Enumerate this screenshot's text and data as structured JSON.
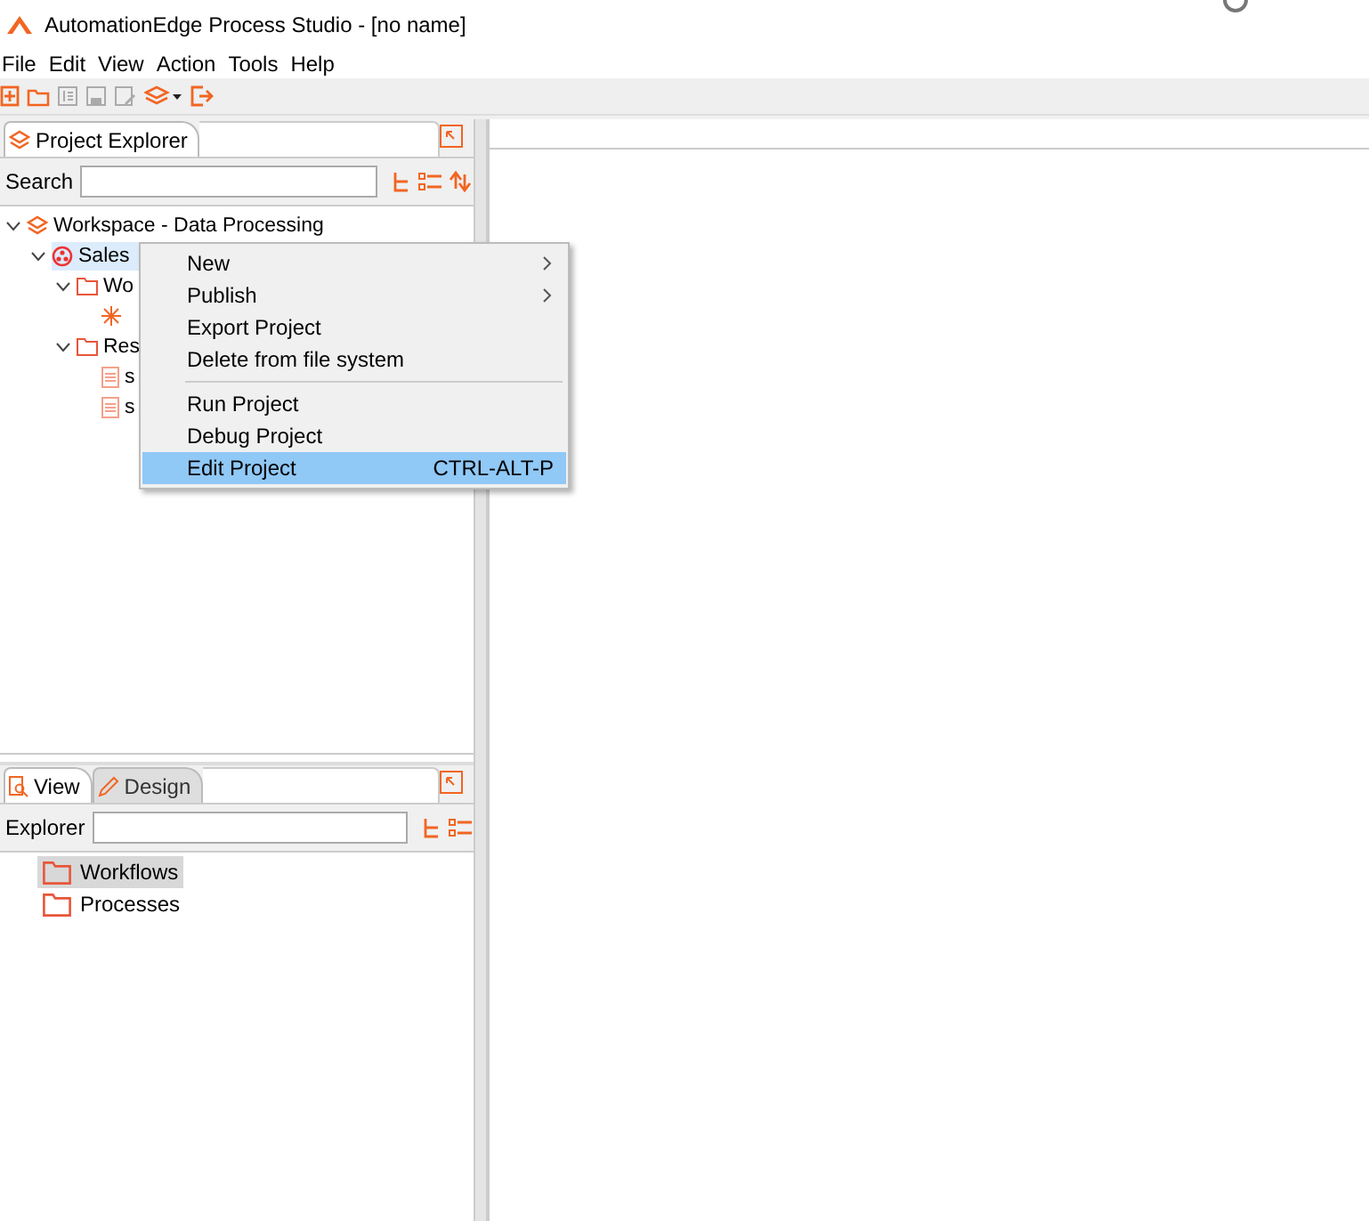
{
  "window": {
    "title": "AutomationEdge Process Studio - [no name]"
  },
  "menu_bar": [
    {
      "label": "File"
    },
    {
      "label": "Edit"
    },
    {
      "label": "View"
    },
    {
      "label": "Action"
    },
    {
      "label": "Tools"
    },
    {
      "label": "Help"
    }
  ],
  "project_explorer": {
    "tab": "Project Explorer",
    "search_label": "Search",
    "tree": [
      {
        "label": "Workspace - Data Processing",
        "kind": "workspace",
        "expanded": true,
        "selected": false,
        "children": [
          {
            "label": "Sales",
            "kind": "project",
            "expanded": true,
            "selected": true,
            "children": [
              {
                "label": "Wo",
                "kind": "folder",
                "expanded": true,
                "selected": false,
                "children": [
                  {
                    "kind": "workflow",
                    "selected": false
                  }
                ]
              },
              {
                "label": "Res",
                "kind": "folder",
                "expanded": true,
                "selected": false,
                "children": [
                  {
                    "label": "s",
                    "kind": "file",
                    "selected": false
                  },
                  {
                    "label": "s",
                    "kind": "file",
                    "selected": false
                  }
                ]
              }
            ]
          }
        ]
      }
    ]
  },
  "context_menu": [
    {
      "kind": "item",
      "label": "New",
      "submenu": true,
      "selected": false
    },
    {
      "kind": "item",
      "label": "Publish",
      "submenu": true,
      "selected": false
    },
    {
      "kind": "item",
      "label": "Export Project",
      "submenu": false,
      "selected": false
    },
    {
      "kind": "item",
      "label": "Delete from file system",
      "submenu": false,
      "selected": false
    },
    {
      "kind": "separator"
    },
    {
      "kind": "item",
      "label": "Run Project",
      "submenu": false,
      "selected": false
    },
    {
      "kind": "item",
      "label": "Debug Project",
      "submenu": false,
      "selected": false
    },
    {
      "kind": "item",
      "label": "Edit Project",
      "shortcut": "CTRL-ALT-P",
      "submenu": false,
      "selected": true
    }
  ],
  "view_panel": {
    "tabs": [
      {
        "label": "View",
        "selected": true
      },
      {
        "label": "Design",
        "selected": false
      }
    ],
    "explorer_label": "Explorer",
    "items": [
      {
        "label": "Workflows",
        "selected": true
      },
      {
        "label": "Processes",
        "selected": false
      }
    ]
  }
}
